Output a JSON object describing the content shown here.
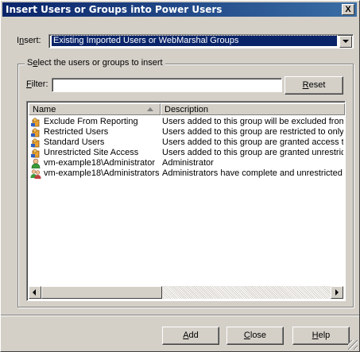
{
  "window": {
    "title": "Insert Users or Groups into Power Users",
    "close_label": "X"
  },
  "insert": {
    "label_prefix": "I",
    "label_underline": "n",
    "label_suffix": "sert:",
    "value": "Existing Imported Users or WebMarshal Groups"
  },
  "group": {
    "label_prefix": "S",
    "label_underline": "e",
    "label_suffix": "lect the users or groups to insert",
    "filter_label_underline": "F",
    "filter_label_suffix": "ilter:",
    "filter_value": "",
    "reset_underline": "R",
    "reset_suffix": "eset"
  },
  "list": {
    "columns": [
      "Name",
      "Description"
    ],
    "rows": [
      {
        "icon": "group-icon",
        "name": "Exclude From Reporting",
        "description": "Users added to this group will be excluded from r"
      },
      {
        "icon": "group-icon",
        "name": "Restricted Users",
        "description": "Users added to this group are restricted to only vi"
      },
      {
        "icon": "group-icon",
        "name": "Standard Users",
        "description": "Users added to this group are granted access to"
      },
      {
        "icon": "group-icon",
        "name": "Unrestricted Site Access",
        "description": "Users added to this group are granted unrestricte"
      },
      {
        "icon": "user-icon",
        "name": "vm-example18\\Administrator",
        "description": "Administrator"
      },
      {
        "icon": "users-icon",
        "name": "vm-example18\\Administrators",
        "description": "Administrators have complete and unrestricted ac"
      }
    ]
  },
  "buttons": {
    "add_underline": "A",
    "add_suffix": "dd",
    "close_underline": "C",
    "close_suffix": "lose",
    "help_underline": "H",
    "help_suffix": "elp"
  },
  "colors": {
    "titlebar": "#0a246a",
    "selection": "#0a246a",
    "face": "#d4d0c8"
  }
}
